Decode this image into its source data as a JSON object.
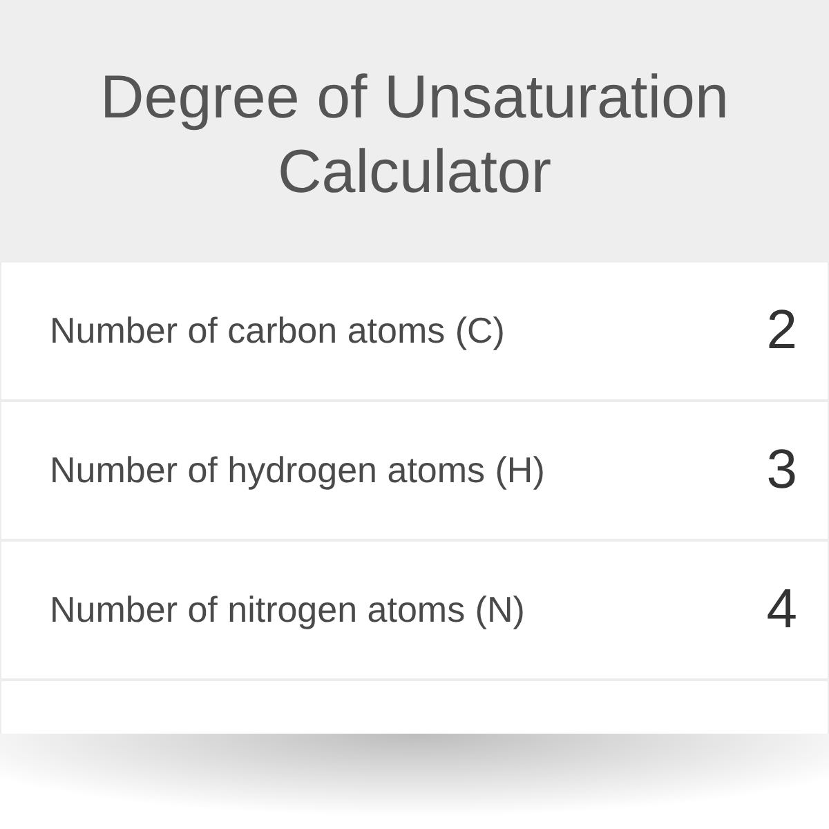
{
  "title": "Degree of Unsaturation Calculator",
  "fields": [
    {
      "label": "Number of carbon atoms (C)",
      "value": "2"
    },
    {
      "label": "Number of hydrogen atoms (H)",
      "value": "3"
    },
    {
      "label": "Number of nitrogen atoms (N)",
      "value": "4"
    }
  ]
}
